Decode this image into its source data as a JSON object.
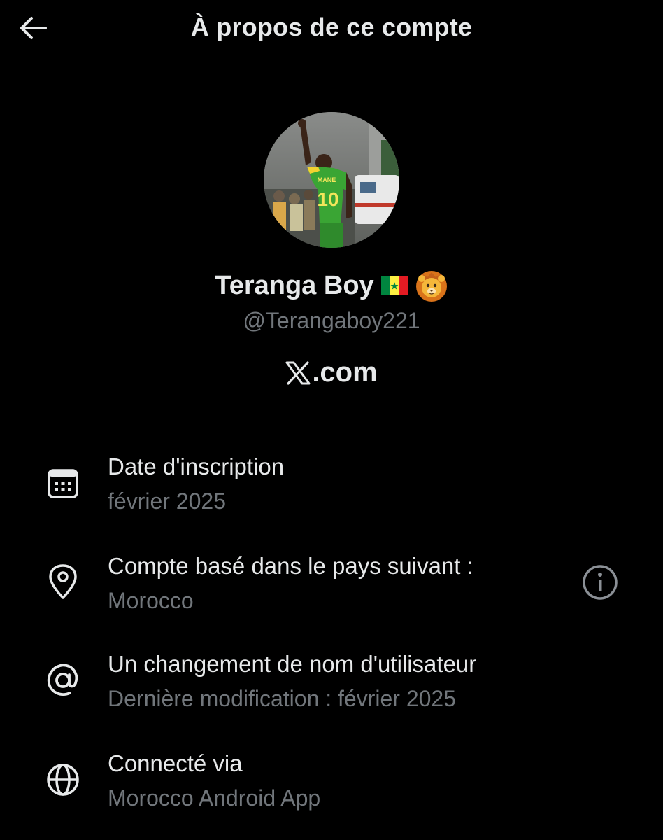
{
  "header": {
    "title": "À propos de ce compte",
    "back_icon": "arrow-left-icon"
  },
  "profile": {
    "display_name": "Teranga Boy",
    "emojis": [
      "senegal-flag-icon",
      "lion-face-icon"
    ],
    "handle": "@Terangaboy221",
    "jersey_name": "MANE",
    "jersey_number": "10",
    "site_logo_icon": "x-logo-icon",
    "site_domain": ".com"
  },
  "rows": [
    {
      "icon": "calendar-icon",
      "title": "Date d'inscription",
      "subtitle": "février 2025"
    },
    {
      "icon": "location-pin-icon",
      "title": "Compte basé dans le pays suivant :",
      "subtitle": "Morocco",
      "action_icon": "info-icon"
    },
    {
      "icon": "at-sign-icon",
      "title": "Un changement de nom d'utilisateur",
      "subtitle": "Dernière modification : février 2025"
    },
    {
      "icon": "globe-icon",
      "title": "Connecté via",
      "subtitle": "Morocco Android App"
    }
  ],
  "colors": {
    "background": "#000000",
    "primary_text": "#e7e9ea",
    "secondary_text": "#71767b"
  }
}
